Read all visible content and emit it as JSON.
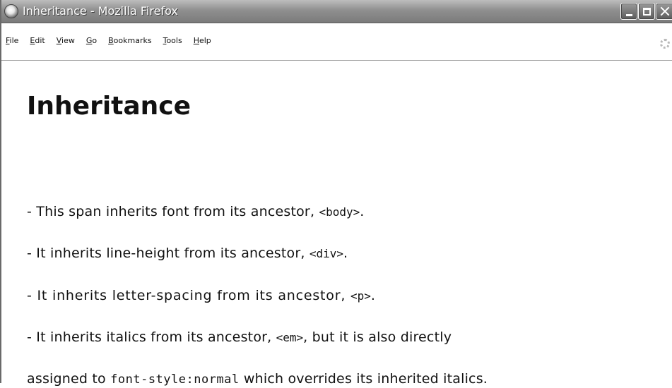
{
  "window": {
    "title": "Inheritance - Mozilla Firefox",
    "icon": "firefox-icon",
    "controls": [
      "minimize",
      "maximize",
      "close"
    ]
  },
  "menu": {
    "items": [
      {
        "label": "File",
        "accesskey": "F"
      },
      {
        "label": "Edit",
        "accesskey": "E"
      },
      {
        "label": "View",
        "accesskey": "V"
      },
      {
        "label": "Go",
        "accesskey": "G"
      },
      {
        "label": "Bookmarks",
        "accesskey": "B"
      },
      {
        "label": "Tools",
        "accesskey": "T"
      },
      {
        "label": "Help",
        "accesskey": "H"
      }
    ]
  },
  "page": {
    "heading": "Inheritance",
    "lines": [
      {
        "text": "- This span inherits font from its ancestor, ",
        "code": "<body>",
        "after": "."
      },
      {
        "text": "- It inherits line-height from its ancestor, ",
        "code": "<div>",
        "after": "."
      },
      {
        "text": "- It inherits letter-spacing from its ancestor, ",
        "code": "<p>",
        "after": "."
      },
      {
        "text": "- It inherits italics from its ancestor, ",
        "code": "<em>",
        "after": ", but it is also directly"
      },
      {
        "text": "assigned to ",
        "code": "font-style:normal",
        "after": "  which overrides its inherited italics."
      }
    ]
  }
}
